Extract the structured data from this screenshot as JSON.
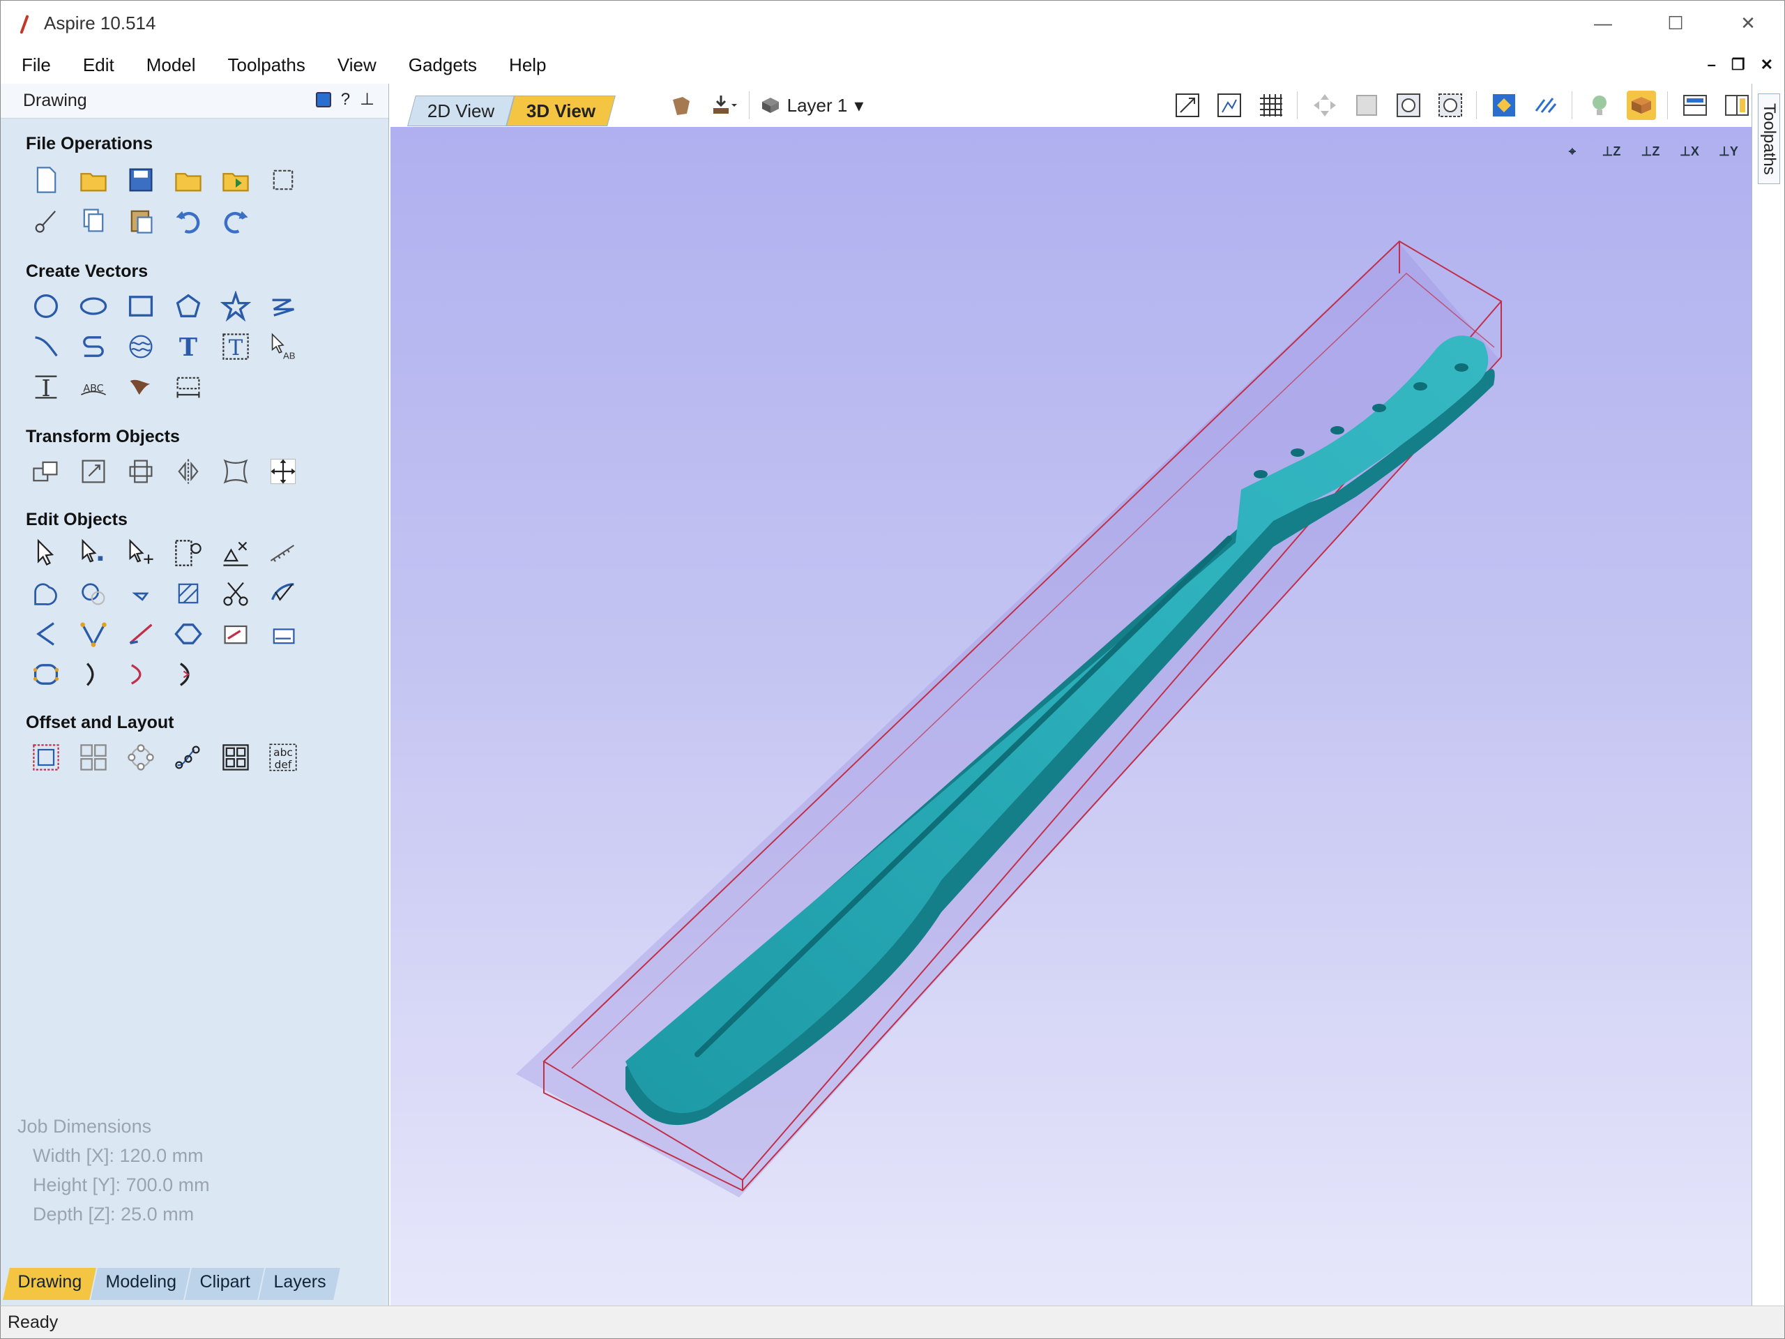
{
  "window": {
    "title": "Aspire 10.514",
    "minimize": "—",
    "maximize": "☐",
    "close": "✕"
  },
  "menu": [
    "File",
    "Edit",
    "Model",
    "Toolpaths",
    "View",
    "Gadgets",
    "Help"
  ],
  "mdi": {
    "minimize": "–",
    "restore": "❐",
    "close": "✕"
  },
  "panel": {
    "header": "Drawing",
    "help": "?",
    "sections": {
      "file_ops": "File Operations",
      "create_vectors": "Create Vectors",
      "transform": "Transform Objects",
      "edit": "Edit Objects",
      "offset": "Offset and Layout"
    }
  },
  "job": {
    "title": "Job Dimensions",
    "width": "Width  [X]: 120.0 mm",
    "height": "Height [Y]: 700.0 mm",
    "depth": "Depth  [Z]: 25.0 mm"
  },
  "bottom_tabs": [
    "Drawing",
    "Modeling",
    "Clipart",
    "Layers"
  ],
  "view_tabs": {
    "tab2d": "2D View",
    "tab3d": "3D View"
  },
  "layer": {
    "label": "Layer 1",
    "arrow": "▾"
  },
  "orient": [
    "⌖",
    "⊥Z",
    "⊥Z",
    "⊥X",
    "⊥Y"
  ],
  "right_tab": "Toolpaths",
  "status": "Ready",
  "colors": {
    "panel_bg": "#dbe8f4",
    "accent_tab": "#f4c542",
    "model": "#2aa6b0",
    "box_edge": "#c0304a"
  }
}
